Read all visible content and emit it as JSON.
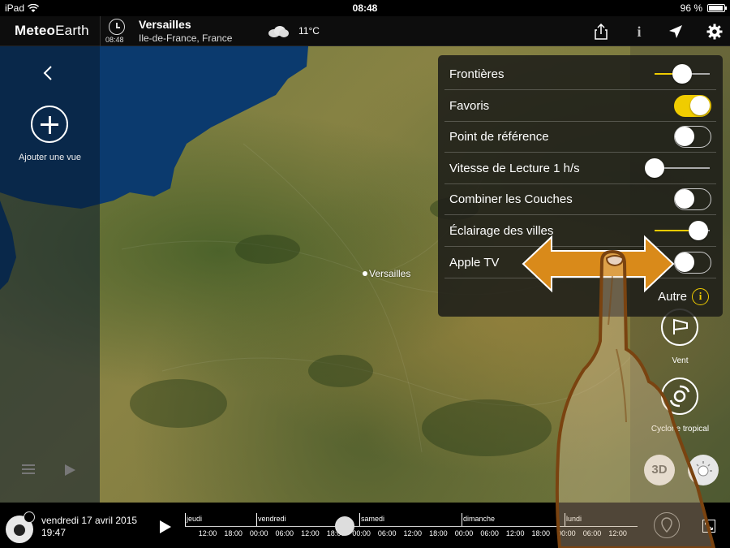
{
  "status_bar": {
    "device": "iPad",
    "time": "08:48",
    "battery": "96 %",
    "battery_fraction": 0.96
  },
  "header": {
    "logo_bold": "Meteo",
    "logo_regular": "Earth",
    "clock_time": "08:48",
    "city": "Versailles",
    "region": "Ile-de-France, France",
    "temperature": "11°C",
    "weather_icon": "cloud-icon",
    "info_glyph": "i"
  },
  "left_panel": {
    "add_view_label": "Ajouter une vue"
  },
  "map": {
    "city_label": "Versailles"
  },
  "settings": {
    "rows": [
      {
        "label": "Frontières",
        "control": "slider",
        "value": 0.5
      },
      {
        "label": "Favoris",
        "control": "toggle",
        "on": true
      },
      {
        "label": "Point de référence",
        "control": "toggle",
        "on": false
      },
      {
        "label": "Vitesse de Lecture 1 h/s",
        "control": "slider",
        "value": 0.0
      },
      {
        "label": "Combiner les Couches",
        "control": "toggle",
        "on": false
      },
      {
        "label": "Éclairage des villes",
        "control": "slider",
        "value": 0.8
      },
      {
        "label": "Apple TV",
        "control": "toggle",
        "on": false
      }
    ],
    "autre_label": "Autre",
    "autre_icon": "i"
  },
  "layers": {
    "wind_label": "Vent",
    "cyclone_label": "Cyclone tropical",
    "btn_3d": "3D"
  },
  "bottom": {
    "date": "vendredi 17 avril 2015",
    "time": "19:47",
    "days": [
      "jeudi",
      "vendredi",
      "samedi",
      "dimanche",
      "lundi"
    ],
    "hours": [
      "12:00",
      "18:00",
      "00:00",
      "06:00",
      "12:00",
      "18:00",
      "00:00",
      "06:00",
      "12:00",
      "18:00",
      "00:00",
      "06:00",
      "12:00",
      "18:00",
      "00:00",
      "06:00",
      "12:00"
    ]
  },
  "colors": {
    "accent": "#f0cc00",
    "sea": "#0b3a6e",
    "arrow": "#d98a1a"
  }
}
